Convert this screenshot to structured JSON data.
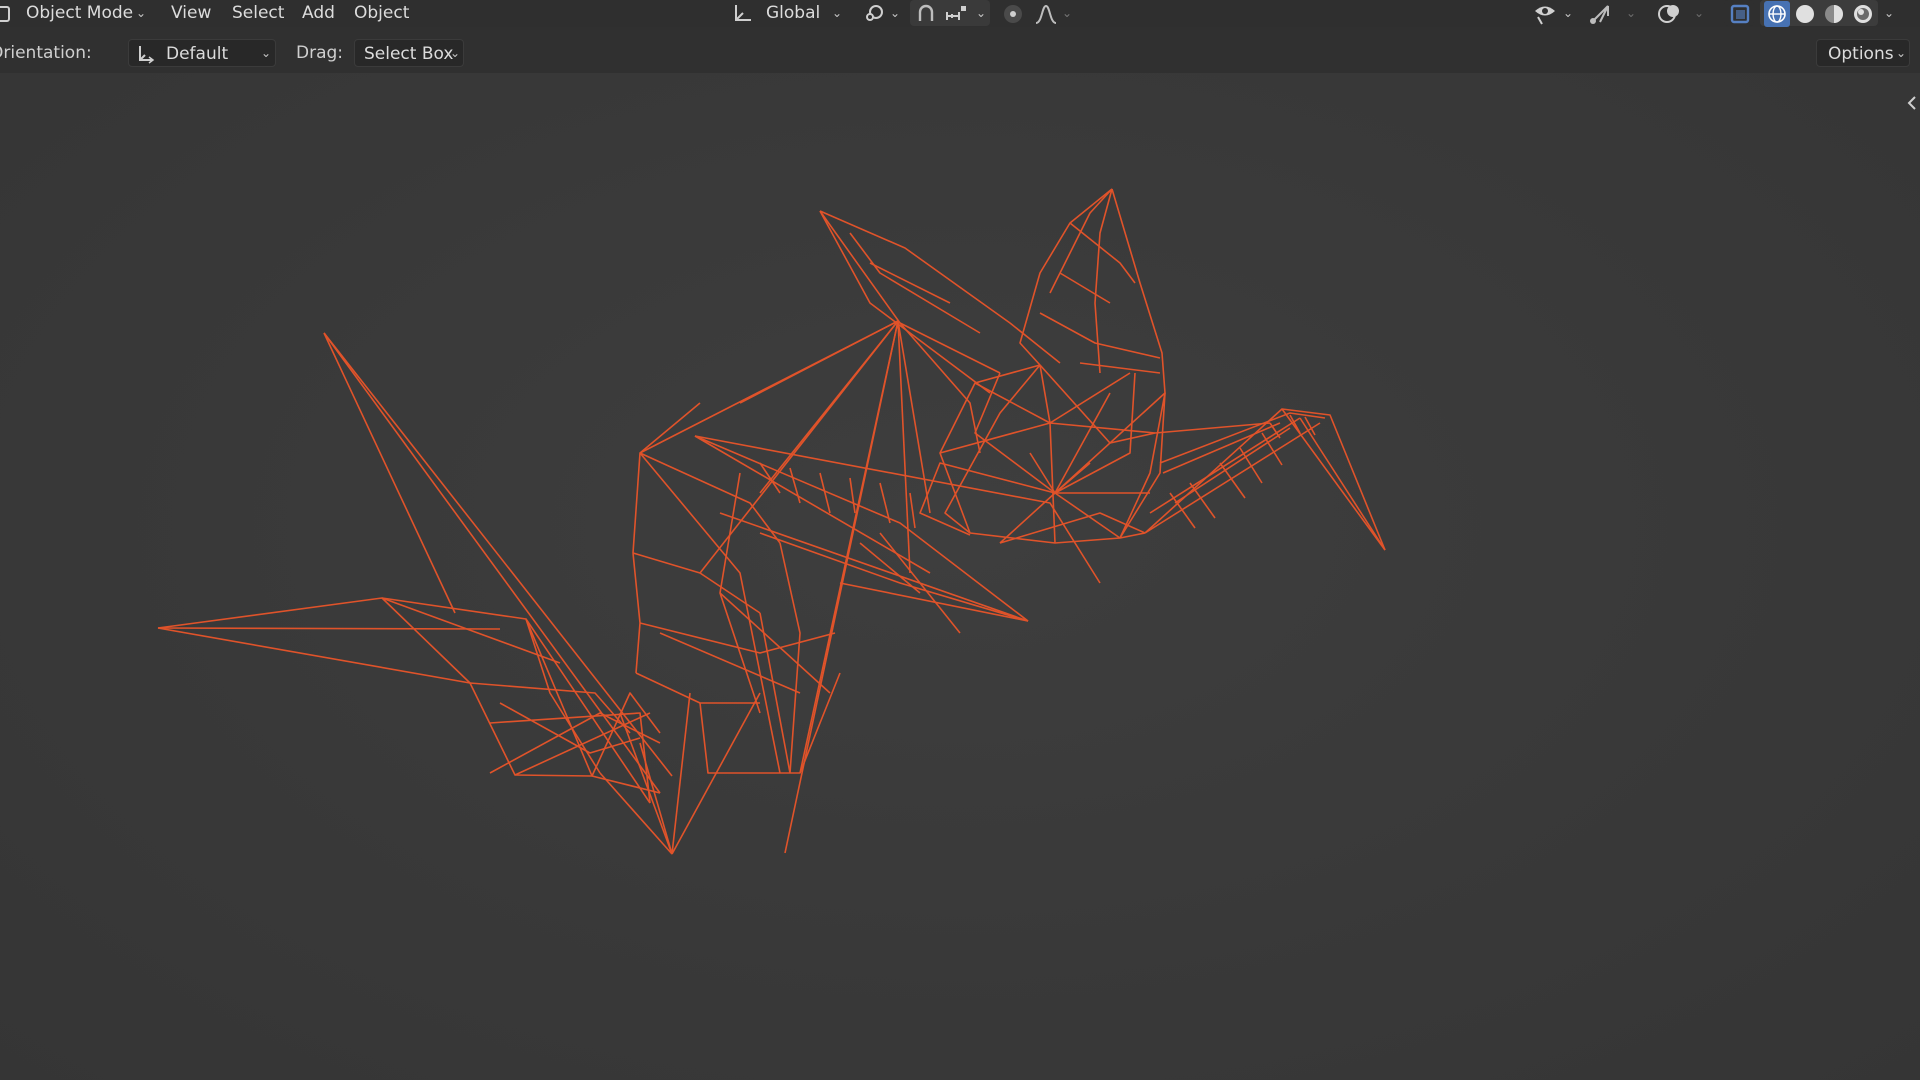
{
  "header": {
    "mode": "Object Mode",
    "menus": [
      "View",
      "Select",
      "Add",
      "Object"
    ],
    "transform_orientation": "Global"
  },
  "toolsettings": {
    "orientation_label": "Orientation:",
    "orientation_value": "Default",
    "drag_label": "Drag:",
    "drag_value": "Select Box",
    "options_label": "Options"
  },
  "colors": {
    "wireframe": "#e0532a",
    "background": "#3a3a3a",
    "header": "#2f2f2f",
    "accent": "#5680c2"
  },
  "icons": [
    "object-mode-icon",
    "transform-orientation-icon",
    "pivot-icon",
    "snap-icon",
    "snap-increment-icon",
    "proportional-editing-icon",
    "falloff-icon",
    "visibility-icon",
    "gizmo-icon",
    "overlay-icon",
    "xray-icon",
    "wireframe-shading-icon",
    "solid-shading-icon",
    "material-preview-icon",
    "rendered-shading-icon",
    "sidebar-toggle-icon"
  ]
}
